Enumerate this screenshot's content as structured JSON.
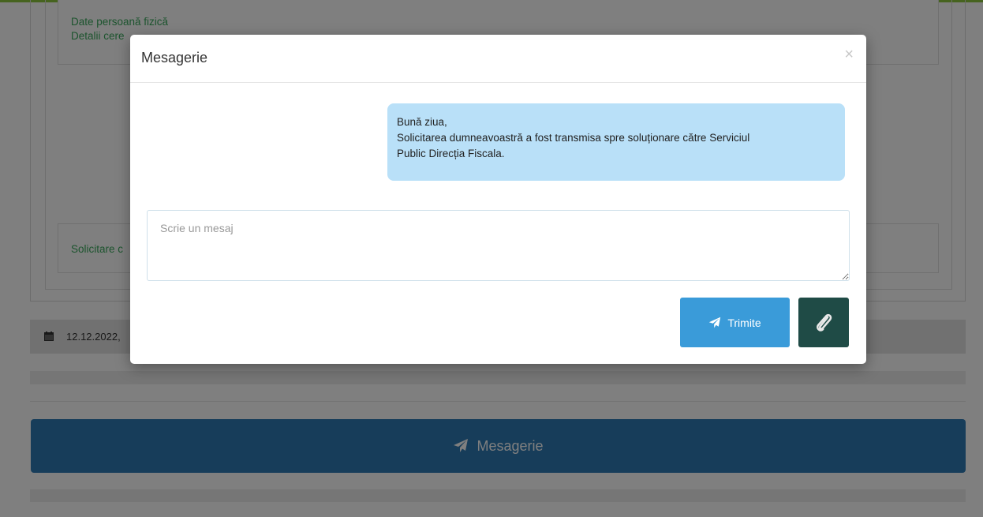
{
  "background": {
    "details_box": {
      "line1": "Date persoană fizică",
      "line2": "Detalii cere"
    },
    "request_box": {
      "label": "Solicitare c"
    },
    "date_bar": {
      "icon": "calendar-icon",
      "date": "12.12.2022, "
    },
    "messaging_button": {
      "icon": "paper-plane-icon",
      "label": "Mesagerie"
    }
  },
  "modal": {
    "title": "Mesagerie",
    "close_label": "×",
    "message": {
      "line1": "Bună ziua,",
      "line2": "Solicitarea dumneavoastră a fost transmisa spre soluționare către Serviciul",
      "line3": "Public Direcția Fiscala."
    },
    "input": {
      "placeholder": "Scrie un mesaj",
      "value": ""
    },
    "send_button": {
      "icon": "paper-plane-icon",
      "label": "Trimite"
    },
    "attach_button": {
      "icon": "paperclip-icon"
    }
  },
  "colors": {
    "accent_green": "#8cc63f",
    "link_green": "#39a85c",
    "primary_blue": "#2e7ab5",
    "send_blue": "#3a9bd9",
    "attach_dark": "#1f4b46",
    "bubble": "#b9e0f8"
  }
}
